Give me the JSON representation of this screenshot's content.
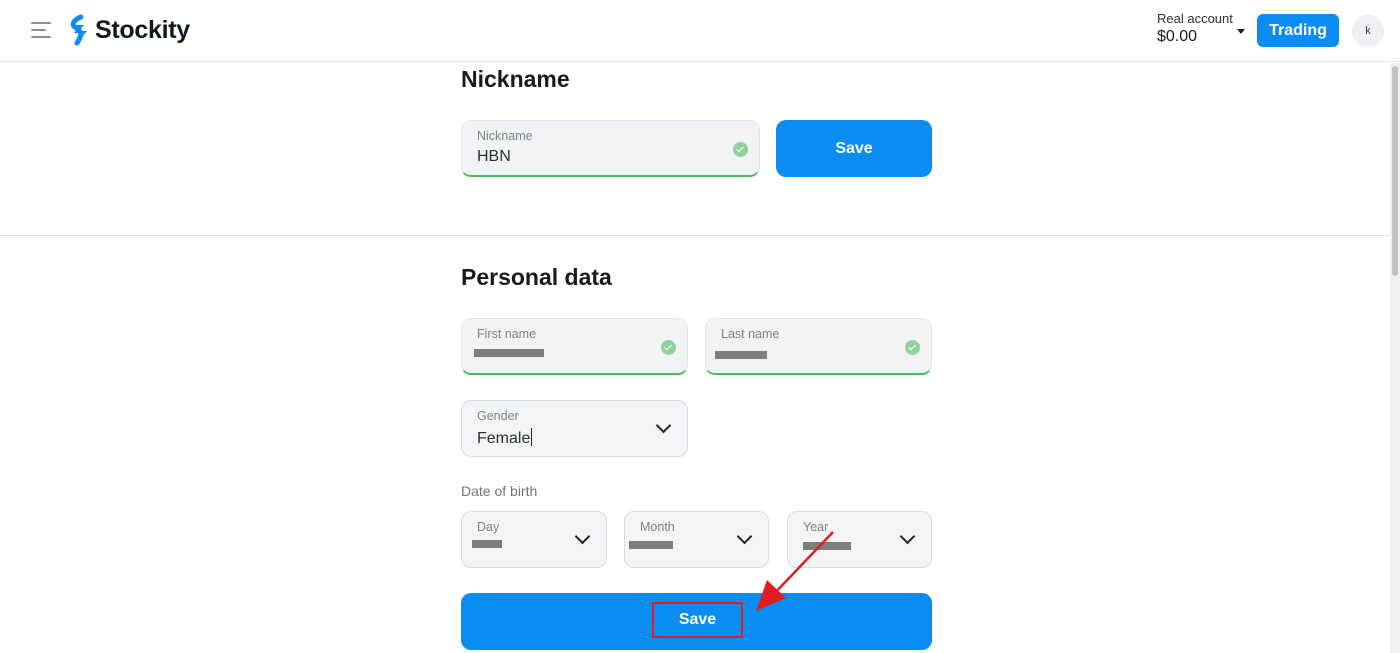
{
  "header": {
    "brand": "Stockity",
    "account_label": "Real account",
    "account_balance": "$0.00",
    "trading_button": "Trading",
    "avatar_initial": "k"
  },
  "nickname_section": {
    "title": "Nickname",
    "field_label": "Nickname",
    "field_value": "HBN",
    "save_button": "Save"
  },
  "personal_section": {
    "title": "Personal data",
    "first_name_label": "First name",
    "last_name_label": "Last name",
    "gender_label": "Gender",
    "gender_value": "Female",
    "dob_label": "Date of birth",
    "day_label": "Day",
    "month_label": "Month",
    "year_label": "Year",
    "save_button": "Save"
  },
  "colors": {
    "accent": "#0a8cf0",
    "valid": "#4cbb5c",
    "annotation": "#e01d24"
  }
}
